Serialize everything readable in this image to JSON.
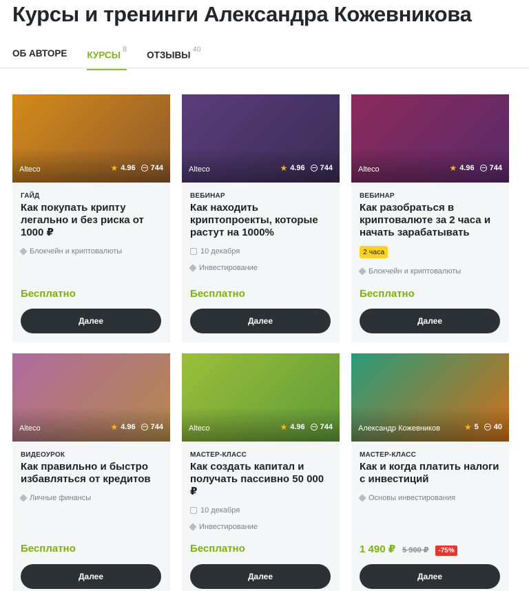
{
  "page": {
    "title": "Курсы и тренинги Александра Кожевникова"
  },
  "tabs": [
    {
      "label": "ОБ АВТОРЕ",
      "count": ""
    },
    {
      "label": "КУРСЫ",
      "count": "8"
    },
    {
      "label": "ОТЗЫВЫ",
      "count": "40"
    }
  ],
  "colors": {
    "accent": "#8cbf1e",
    "button": "#2c3135",
    "badge": "#ffd21f",
    "discount": "#e8362f"
  },
  "cards": [
    {
      "author": "Alteco",
      "rating": "4.96",
      "reviews": "744",
      "type": "ГАЙД",
      "title": "Как покупать крипту легально и без риска от 1000 ₽",
      "date": "",
      "tag": "Блокчейн и криптовалюты",
      "badge": "",
      "price": "Бесплатно",
      "old_price": "",
      "discount": "",
      "button": "Далее",
      "thumb_colors": [
        "#d48a1a",
        "#8f5a2b"
      ]
    },
    {
      "author": "Alteco",
      "rating": "4.96",
      "reviews": "744",
      "type": "ВЕБИНАР",
      "title": "Как находить криптопроекты, которые растут на 1000%",
      "date": "10 декабря",
      "tag": "Инвестирование",
      "badge": "",
      "price": "Бесплатно",
      "old_price": "",
      "discount": "",
      "button": "Далее",
      "thumb_colors": [
        "#5a3d7a",
        "#3a2c55"
      ]
    },
    {
      "author": "Alteco",
      "rating": "4.96",
      "reviews": "744",
      "type": "ВЕБИНАР",
      "title": "Как разобраться в криптовалюте за 2 часа и начать зарабатывать",
      "date": "",
      "tag": "Блокчейн и криптовалюты",
      "badge": "2 часа",
      "price": "Бесплатно",
      "old_price": "",
      "discount": "",
      "button": "Далее",
      "thumb_colors": [
        "#8a2a5a",
        "#5a2a6a"
      ]
    },
    {
      "author": "Alteco",
      "rating": "4.96",
      "reviews": "744",
      "type": "ВИДЕОУРОК",
      "title": "Как правильно и быстро избавляться от кредитов",
      "date": "",
      "tag": "Личные финансы",
      "badge": "",
      "price": "Бесплатно",
      "old_price": "",
      "discount": "",
      "button": "Далее",
      "thumb_colors": [
        "#b06aa0",
        "#b58a4a"
      ]
    },
    {
      "author": "Alteco",
      "rating": "4.96",
      "reviews": "744",
      "type": "МАСТЕР-КЛАСС",
      "title": "Как создать капитал и получать пассивно 50 000 ₽",
      "date": "10 декабря",
      "tag": "Инвестирование",
      "badge": "",
      "price": "Бесплатно",
      "old_price": "",
      "discount": "",
      "button": "Далее",
      "thumb_colors": [
        "#9bbf3a",
        "#5f9a3a"
      ]
    },
    {
      "author": "Александр Кожевников",
      "rating": "5",
      "reviews": "40",
      "type": "МАСТЕР-КЛАСС",
      "title": "Как и когда платить налоги с инвестиций",
      "date": "",
      "tag": "Основы инвестирования",
      "badge": "",
      "price": "1 490 ₽",
      "old_price": "5 900 ₽",
      "discount": "-75%",
      "button": "Далее",
      "thumb_colors": [
        "#2a9a7a",
        "#d0701a"
      ]
    }
  ]
}
